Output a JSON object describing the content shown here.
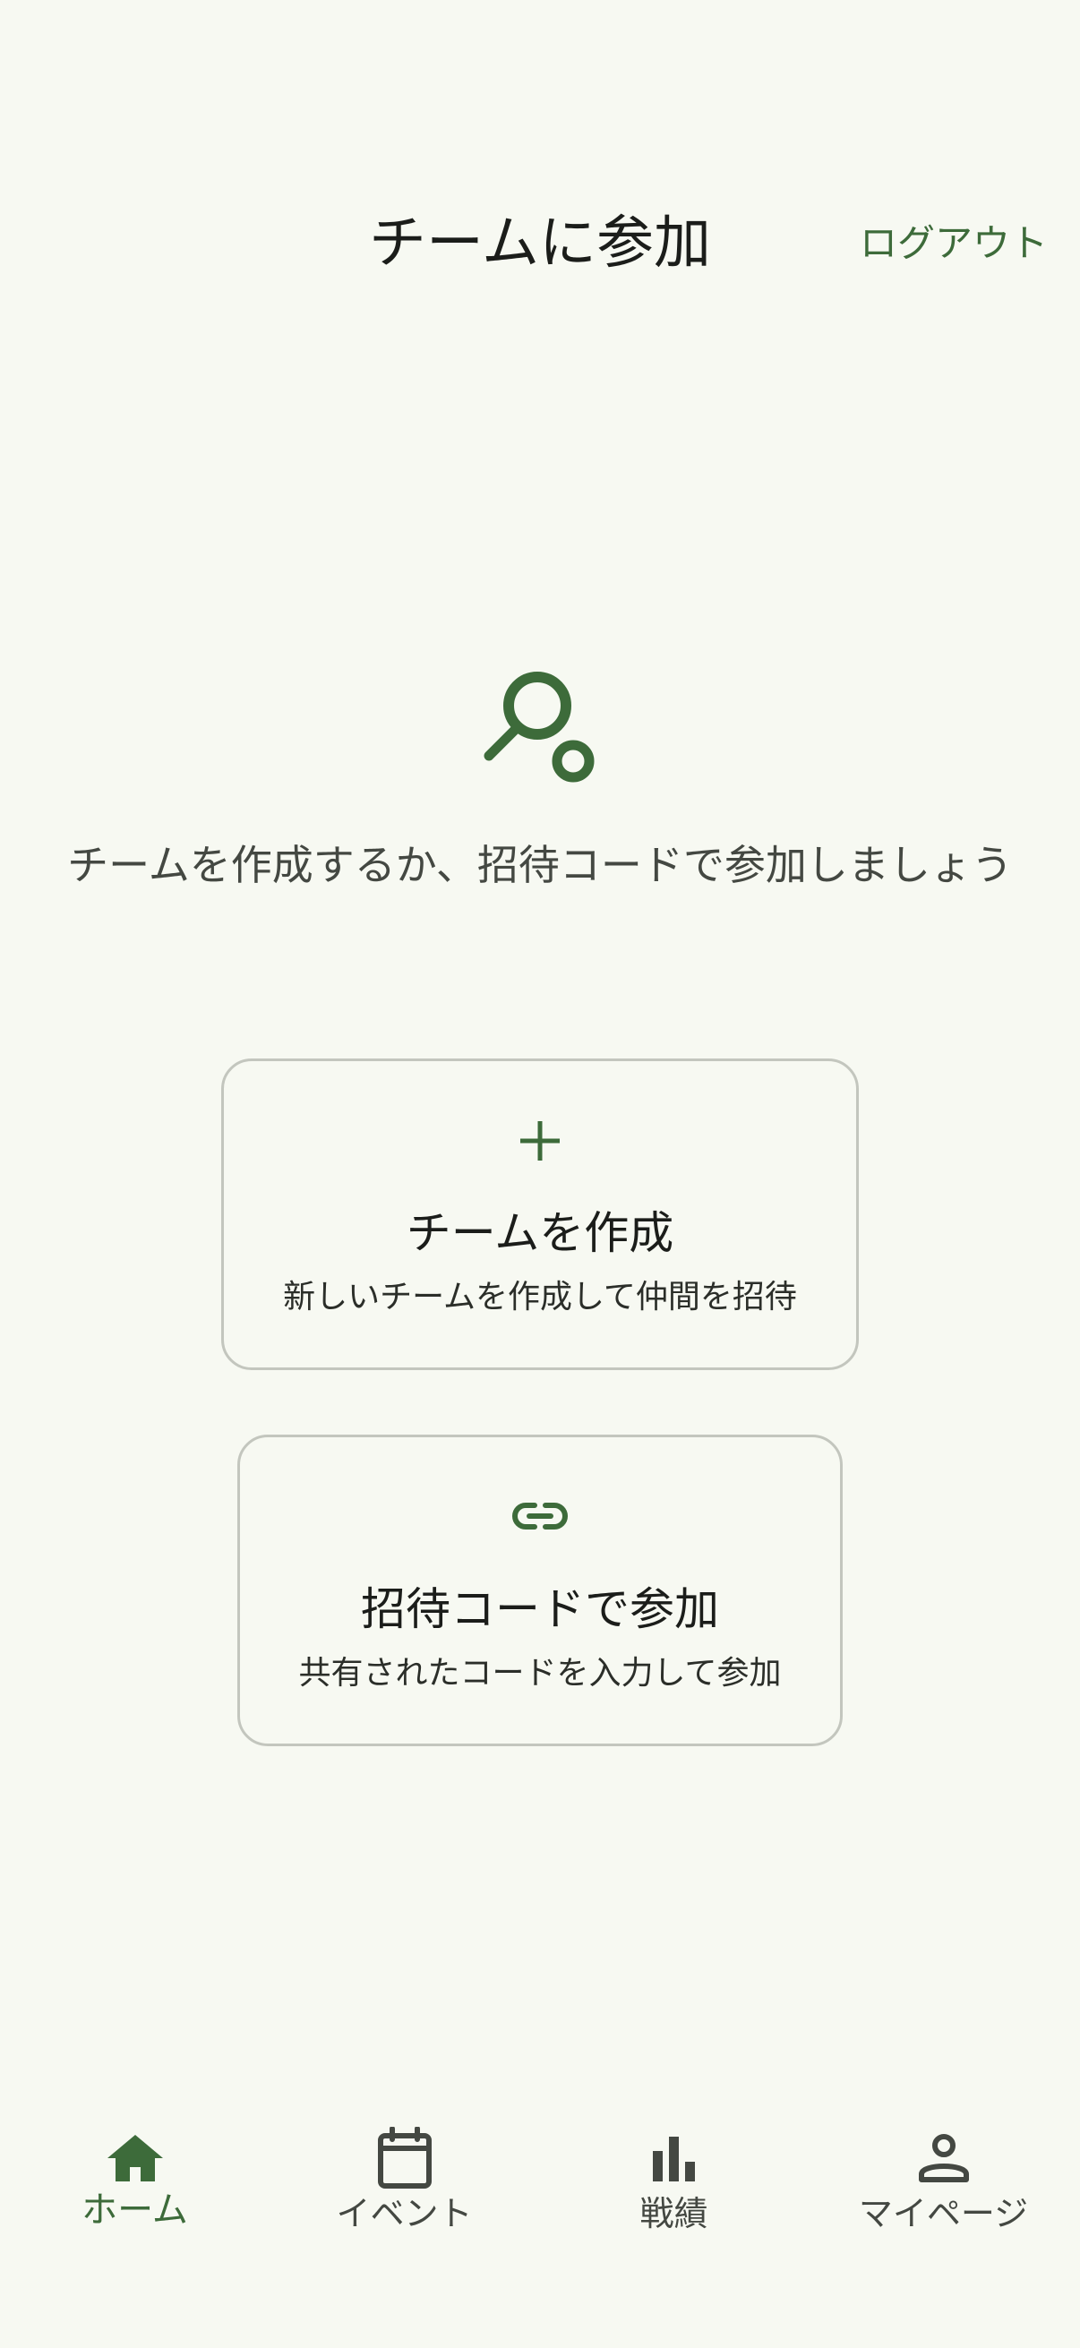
{
  "header": {
    "title": "チームに参加",
    "logout_label": "ログアウト"
  },
  "main": {
    "hero_icon": "racket-icon",
    "intro_text": "チームを作成するか、招待コードで参加しましょう"
  },
  "cards": {
    "create": {
      "icon": "plus-icon",
      "title": "チームを作成",
      "subtitle": "新しいチームを作成して仲間を招待"
    },
    "join": {
      "icon": "link-icon",
      "title": "招待コードで参加",
      "subtitle": "共有されたコードを入力して参加"
    }
  },
  "bottom_nav": {
    "items": [
      {
        "label": "ホーム",
        "icon": "home-icon",
        "active": true
      },
      {
        "label": "イベント",
        "icon": "calendar-icon",
        "active": false
      },
      {
        "label": "戦績",
        "icon": "bar-chart-icon",
        "active": false
      },
      {
        "label": "マイページ",
        "icon": "person-icon",
        "active": false
      }
    ]
  },
  "colors": {
    "background": "#f7f9f2",
    "accent": "#3d6b3a",
    "text": "#1b1d1a",
    "muted_text": "#444842",
    "card_border": "#c3c6be"
  }
}
